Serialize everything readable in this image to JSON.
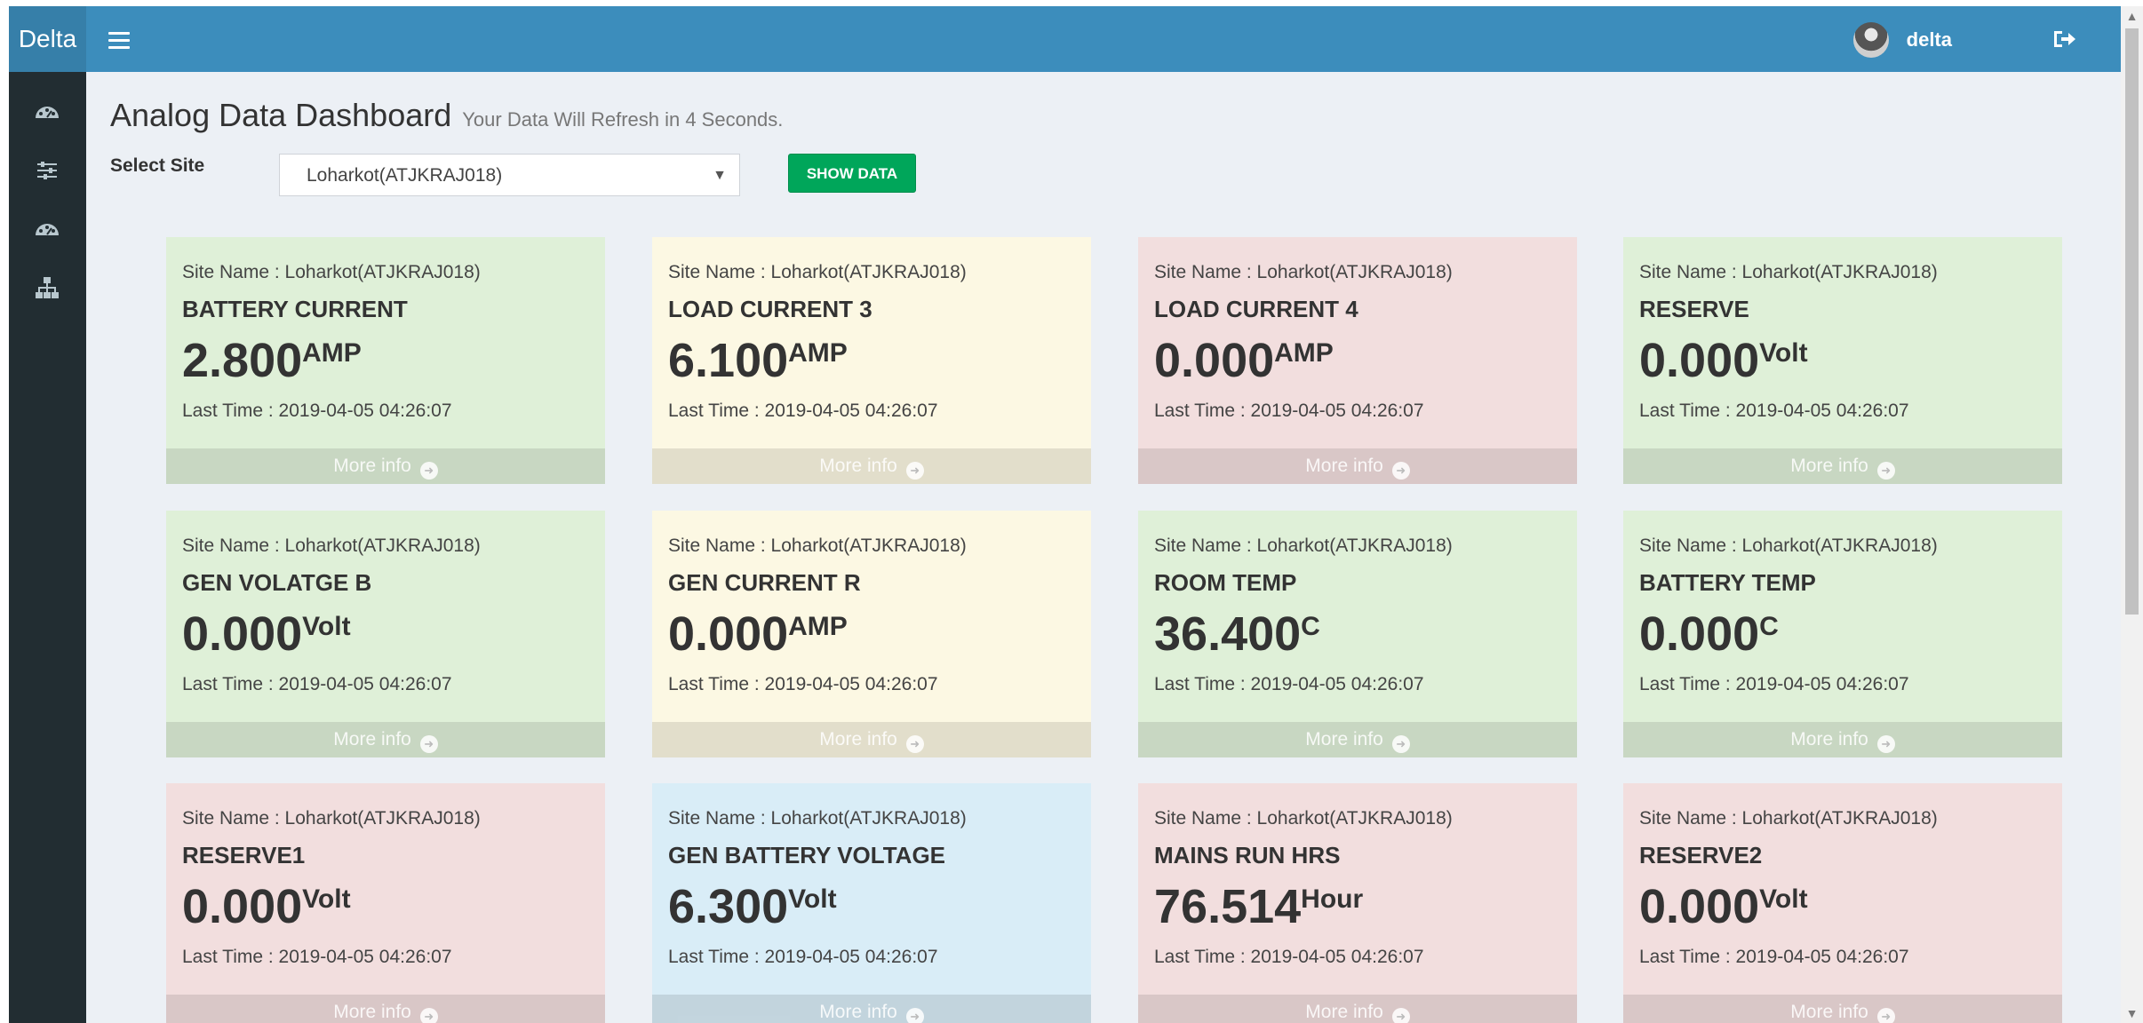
{
  "header": {
    "brand": "Delta",
    "username": "delta"
  },
  "page": {
    "title": "Analog Data Dashboard",
    "subtitle": "Your Data Will Refresh in 4 Seconds.",
    "site_label": "Select Site",
    "site_value": "Loharkot(ATJKRAJ018)",
    "show_button": "SHOW DATA"
  },
  "colors": {
    "green": "#dff0d8",
    "yellow": "#fcf8e3",
    "red": "#f2dede",
    "blue": "#d9edf7"
  },
  "cards": [
    {
      "site": "Site Name : Loharkot(ATJKRAJ018)",
      "name": "BATTERY CURRENT",
      "value": "2.800",
      "unit": "AMP",
      "time": "Last Time : 2019-04-05 04:26:07",
      "more": "More info",
      "color": "green"
    },
    {
      "site": "Site Name : Loharkot(ATJKRAJ018)",
      "name": "LOAD CURRENT 3",
      "value": "6.100",
      "unit": "AMP",
      "time": "Last Time : 2019-04-05 04:26:07",
      "more": "More info",
      "color": "yellow"
    },
    {
      "site": "Site Name : Loharkot(ATJKRAJ018)",
      "name": "LOAD CURRENT 4",
      "value": "0.000",
      "unit": "AMP",
      "time": "Last Time : 2019-04-05 04:26:07",
      "more": "More info",
      "color": "red"
    },
    {
      "site": "Site Name : Loharkot(ATJKRAJ018)",
      "name": "RESERVE",
      "value": "0.000",
      "unit": "Volt",
      "time": "Last Time : 2019-04-05 04:26:07",
      "more": "More info",
      "color": "green"
    },
    {
      "site": "Site Name : Loharkot(ATJKRAJ018)",
      "name": "GEN VOLATGE B",
      "value": "0.000",
      "unit": "Volt",
      "time": "Last Time : 2019-04-05 04:26:07",
      "more": "More info",
      "color": "green"
    },
    {
      "site": "Site Name : Loharkot(ATJKRAJ018)",
      "name": "GEN CURRENT R",
      "value": "0.000",
      "unit": "AMP",
      "time": "Last Time : 2019-04-05 04:26:07",
      "more": "More info",
      "color": "yellow"
    },
    {
      "site": "Site Name : Loharkot(ATJKRAJ018)",
      "name": "ROOM TEMP",
      "value": "36.400",
      "unit": "C",
      "time": "Last Time : 2019-04-05 04:26:07",
      "more": "More info",
      "color": "green"
    },
    {
      "site": "Site Name : Loharkot(ATJKRAJ018)",
      "name": "BATTERY TEMP",
      "value": "0.000",
      "unit": "C",
      "time": "Last Time : 2019-04-05 04:26:07",
      "more": "More info",
      "color": "green"
    },
    {
      "site": "Site Name : Loharkot(ATJKRAJ018)",
      "name": "RESERVE1",
      "value": "0.000",
      "unit": "Volt",
      "time": "Last Time : 2019-04-05 04:26:07",
      "more": "More info",
      "color": "red"
    },
    {
      "site": "Site Name : Loharkot(ATJKRAJ018)",
      "name": "GEN BATTERY VOLTAGE",
      "value": "6.300",
      "unit": "Volt",
      "time": "Last Time : 2019-04-05 04:26:07",
      "more": "More info",
      "color": "blue"
    },
    {
      "site": "Site Name : Loharkot(ATJKRAJ018)",
      "name": "MAINS RUN HRS",
      "value": "76.514",
      "unit": "Hour",
      "time": "Last Time : 2019-04-05 04:26:07",
      "more": "More info",
      "color": "red"
    },
    {
      "site": "Site Name : Loharkot(ATJKRAJ018)",
      "name": "RESERVE2",
      "value": "0.000",
      "unit": "Volt",
      "time": "Last Time : 2019-04-05 04:26:07",
      "more": "More info",
      "color": "red"
    }
  ]
}
